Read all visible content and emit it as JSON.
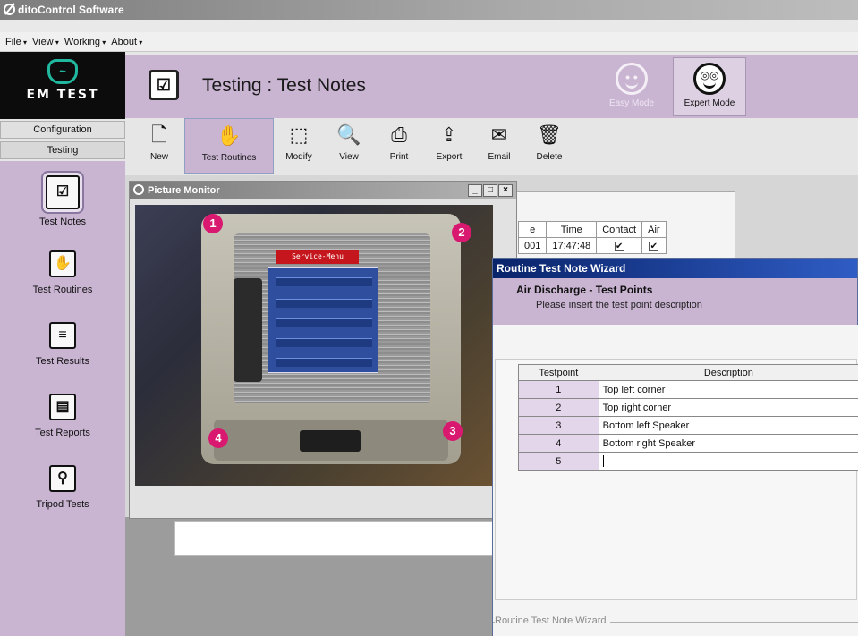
{
  "app": {
    "title": "ditoControl Software"
  },
  "menu": [
    "File",
    "View",
    "Working",
    "About"
  ],
  "logo": {
    "text": "EM TEST"
  },
  "header": {
    "title": "Testing : Test Notes",
    "easy_mode": "Easy Mode",
    "expert_mode": "Expert Mode"
  },
  "left_tabs": {
    "configuration": "Configuration",
    "testing": "Testing"
  },
  "sidebar": {
    "items": [
      {
        "label": "Test Notes"
      },
      {
        "label": "Test Routines"
      },
      {
        "label": "Test Results"
      },
      {
        "label": "Test Reports"
      },
      {
        "label": "Tripod Tests"
      }
    ]
  },
  "toolbar": {
    "new": "New",
    "test_routines": "Test Routines",
    "modify": "Modify",
    "view": "View",
    "print": "Print",
    "export": "Export",
    "email": "Email",
    "delete": "Delete"
  },
  "background_grid": {
    "headers": [
      "e",
      "Time",
      "Contact",
      "Air"
    ],
    "row": [
      "001",
      "17:47:48",
      "✔",
      "✔"
    ]
  },
  "picture_monitor": {
    "title": "Picture Monitor",
    "markers": [
      "1",
      "2",
      "3",
      "4"
    ],
    "tv_menu_title": "Service-Menu"
  },
  "wizard": {
    "title": "Routine Test Note Wizard",
    "heading": "Air Discharge - Test Points",
    "subtitle": "Please insert the test point description",
    "columns": [
      "Testpoint",
      "Description"
    ],
    "rows": [
      {
        "num": "1",
        "desc": "Top left corner"
      },
      {
        "num": "2",
        "desc": "Top right corner"
      },
      {
        "num": "3",
        "desc": "Bottom left Speaker"
      },
      {
        "num": "4",
        "desc": "Bottom right Speaker"
      },
      {
        "num": "5",
        "desc": ""
      }
    ],
    "group_label": "Routine Test Note Wizard"
  }
}
